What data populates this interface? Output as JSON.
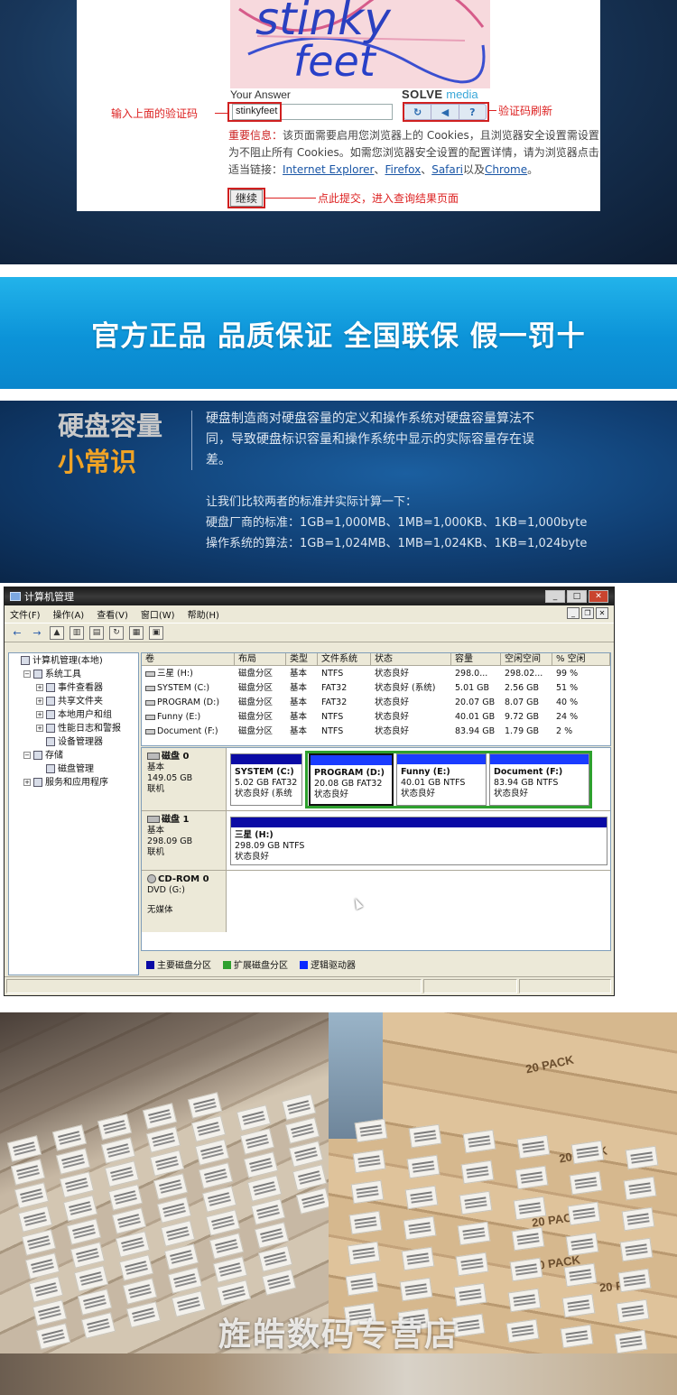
{
  "captcha": {
    "image_text_line1": "stinky",
    "image_text_line2": "feet",
    "your_answer_label": "Your Answer",
    "logo_part1": "SOLVE",
    "logo_part2": "media",
    "answer_value": "stinkyfeet",
    "btn_refresh": "↻",
    "btn_audio": "◀",
    "btn_help": "?",
    "note_input": "输入上面的验证码",
    "note_refresh": "验证码刷新",
    "notice_important": "重要信息：",
    "notice_text1": "该页面需要启用您浏览器上的 Cookies，且浏览器安全设置需设置为不阻止所有 Cookies。如需您浏览器安全设置的配置详情，请为浏览器点击适当链接：",
    "link_ie": "Internet Explorer",
    "sep1": "、",
    "link_firefox": "Firefox",
    "sep2": "、",
    "link_safari": "Safari",
    "sep3": "以及",
    "link_chrome": "Chrome",
    "end": "。",
    "continue_label": "继续",
    "note_submit": "点此提交，进入查询结果页面"
  },
  "banner": {
    "text": "官方正品 品质保证 全国联保 假一罚十"
  },
  "knowledge": {
    "title_line1": "硬盘容量",
    "title_line2": "小常识",
    "desc": "硬盘制造商对硬盘容量的定义和操作系统对硬盘容量算法不同，导致硬盘标识容量和操作系统中显示的实际容量存在误差。",
    "line1": "让我们比较两者的标准并实际计算一下：",
    "line2": "硬盘厂商的标准：1GB=1,000MB、1MB=1,000KB、1KB=1,000byte",
    "line3": "操作系统的算法：1GB=1,024MB、1MB=1,024KB、1KB=1,024byte"
  },
  "window": {
    "title": "计算机管理",
    "menu": [
      "文件(F)",
      "操作(A)",
      "查看(V)",
      "窗口(W)",
      "帮助(H)"
    ],
    "tree": [
      {
        "label": "计算机管理(本地)",
        "indent": 0,
        "pm": ""
      },
      {
        "label": "系统工具",
        "indent": 1,
        "pm": "−"
      },
      {
        "label": "事件查看器",
        "indent": 2,
        "pm": "+"
      },
      {
        "label": "共享文件夹",
        "indent": 2,
        "pm": "+"
      },
      {
        "label": "本地用户和组",
        "indent": 2,
        "pm": "+"
      },
      {
        "label": "性能日志和警报",
        "indent": 2,
        "pm": "+"
      },
      {
        "label": "设备管理器",
        "indent": 2,
        "pm": ""
      },
      {
        "label": "存储",
        "indent": 1,
        "pm": "−"
      },
      {
        "label": "磁盘管理",
        "indent": 2,
        "pm": ""
      },
      {
        "label": "服务和应用程序",
        "indent": 1,
        "pm": "+"
      }
    ],
    "columns": [
      "卷",
      "布局",
      "类型",
      "文件系统",
      "状态",
      "容量",
      "空闲空间",
      "% 空闲"
    ],
    "volumes": [
      [
        "三星 (H:)",
        "磁盘分区",
        "基本",
        "NTFS",
        "状态良好",
        "298.0...",
        "298.02...",
        "99 %"
      ],
      [
        "SYSTEM (C:)",
        "磁盘分区",
        "基本",
        "FAT32",
        "状态良好 (系统)",
        "5.01 GB",
        "2.56 GB",
        "51 %"
      ],
      [
        "PROGRAM (D:)",
        "磁盘分区",
        "基本",
        "FAT32",
        "状态良好",
        "20.07 GB",
        "8.07 GB",
        "40 %"
      ],
      [
        "Funny (E:)",
        "磁盘分区",
        "基本",
        "NTFS",
        "状态良好",
        "40.01 GB",
        "9.72 GB",
        "24 %"
      ],
      [
        "Document (F:)",
        "磁盘分区",
        "基本",
        "NTFS",
        "状态良好",
        "83.94 GB",
        "1.79 GB",
        "2 %"
      ]
    ],
    "disk0": {
      "name": "磁盘 0",
      "type": "基本",
      "size": "149.05 GB",
      "status": "联机",
      "parts": [
        {
          "name": "SYSTEM (C:)",
          "info": "5.02 GB FAT32",
          "status": "状态良好 (系统"
        },
        {
          "name": "PROGRAM (D:)",
          "info": "20.08 GB FAT32",
          "status": "状态良好"
        },
        {
          "name": "Funny (E:)",
          "info": "40.01 GB NTFS",
          "status": "状态良好"
        },
        {
          "name": "Document (F:)",
          "info": "83.94 GB NTFS",
          "status": "状态良好"
        }
      ]
    },
    "disk1": {
      "name": "磁盘 1",
      "type": "基本",
      "size": "298.09 GB",
      "status": "联机",
      "part": {
        "name": "三星 (H:)",
        "info": "298.09 GB NTFS",
        "status": "状态良好"
      }
    },
    "cdrom": {
      "name": "CD-ROM 0",
      "drive": "DVD (G:)",
      "status": "无媒体"
    },
    "legend": [
      "主要磁盘分区",
      "扩展磁盘分区",
      "逻辑驱动器"
    ],
    "legend_colors": [
      "#0a0aa5",
      "#2ea02e",
      "#0a2aff"
    ]
  },
  "photos": {
    "pack_label": "20 PACK",
    "shop_name": "旌皓数码专营店"
  }
}
